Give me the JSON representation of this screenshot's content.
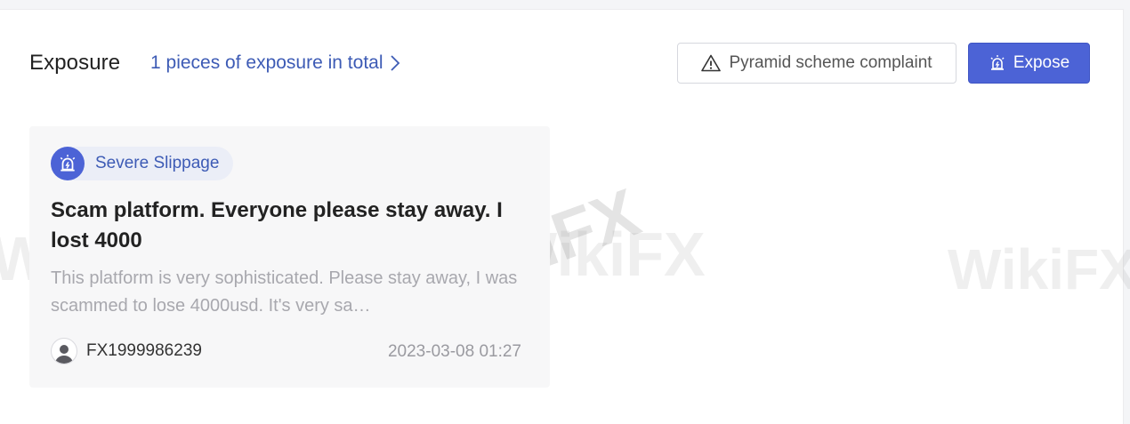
{
  "header": {
    "title": "Exposure",
    "total_link": "1 pieces of exposure in total"
  },
  "actions": {
    "pyramid_label": "Pyramid scheme complaint",
    "expose_label": "Expose"
  },
  "card": {
    "tag": "Severe Slippage",
    "title": "Scam platform. Everyone please stay away. I lost 4000",
    "body": "This platform is very sophisticated. Please stay away, I was scammed to lose 4000usd. It's very sa…",
    "author": "FX1999986239",
    "timestamp": "2023-03-08 01:27"
  },
  "watermark": {
    "text": "WikiFX"
  },
  "colors": {
    "accent": "#4c63d6",
    "link": "#3d5bb5"
  }
}
